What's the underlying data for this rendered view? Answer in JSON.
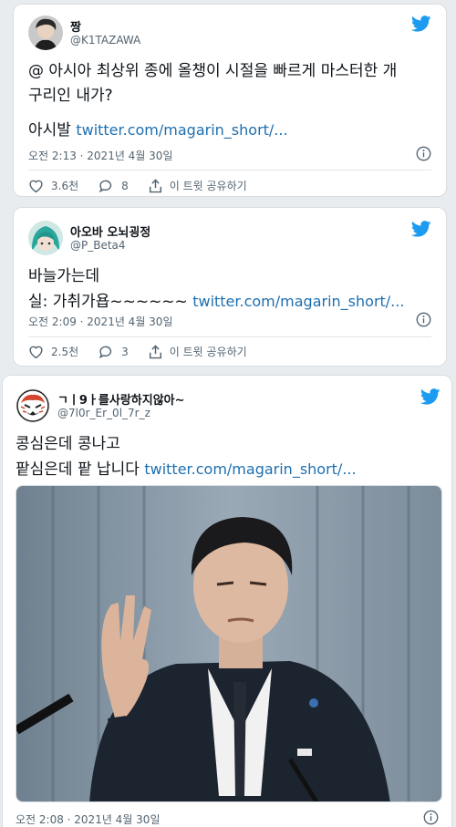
{
  "tweets": [
    {
      "name": "짱",
      "handle": "@K1TAZAWA",
      "text": "@ 아시아 최상위 종에 올챙이 시절을 빠르게 마스터한 개\n구리인 내가?",
      "text2": "아시발 ",
      "link": "twitter.com/magarin_short/...",
      "time": "오전 2:13 · 2021년 4월 30일",
      "likes": "3.6천",
      "replies": "8",
      "share": "이 트윗 공유하기"
    },
    {
      "name": "아오바 오뇌굉정",
      "handle": "@P_Beta4",
      "text": "바늘가는데\n실: 가취가욥~~~~~~ ",
      "link": "twitter.com/magarin_short/...",
      "time": "오전 2:09 · 2021년 4월 30일",
      "likes": "2.5천",
      "replies": "3",
      "share": "이 트윗 공유하기"
    },
    {
      "name": "ㄱㅣ9ㅏ를사랑하지않아~",
      "handle": "@7l0r_Er_0l_7r_z",
      "text": "콩심은데 콩나고\n팥심은데 팥 납니다 ",
      "link": "twitter.com/magarin_short/...",
      "time": "오전 2:08 · 2021년 4월 30일"
    }
  ],
  "colors": {
    "twitter_blue": "#1d9bf0",
    "link": "#1d6fb0"
  }
}
